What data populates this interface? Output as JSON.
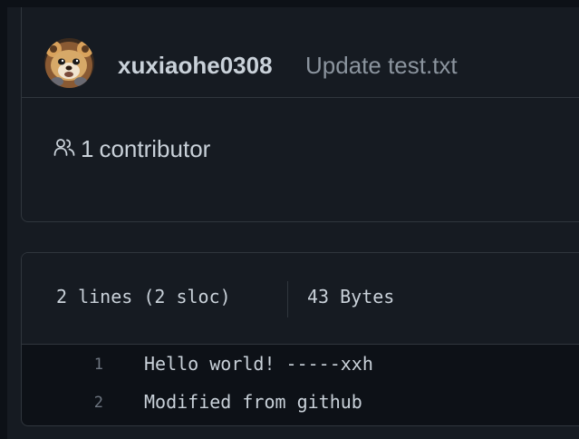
{
  "commit": {
    "author": "xuxiaohe0308",
    "message": "Update test.txt"
  },
  "contributors": {
    "count": "1",
    "label": "contributor"
  },
  "file": {
    "lines_info": "2 lines (2 sloc)",
    "size": "43 Bytes",
    "lines": [
      {
        "number": "1",
        "content": "Hello world! -----xxh"
      },
      {
        "number": "2",
        "content": "Modified from github"
      }
    ]
  },
  "icons": {
    "avatar": "avatar",
    "contributors": "people-icon"
  },
  "colors": {
    "background": "#0d1117",
    "panel": "#161b22",
    "border": "#30363d",
    "text": "#c9d1d9",
    "muted": "#8b949e",
    "line_number": "#6e7681"
  }
}
